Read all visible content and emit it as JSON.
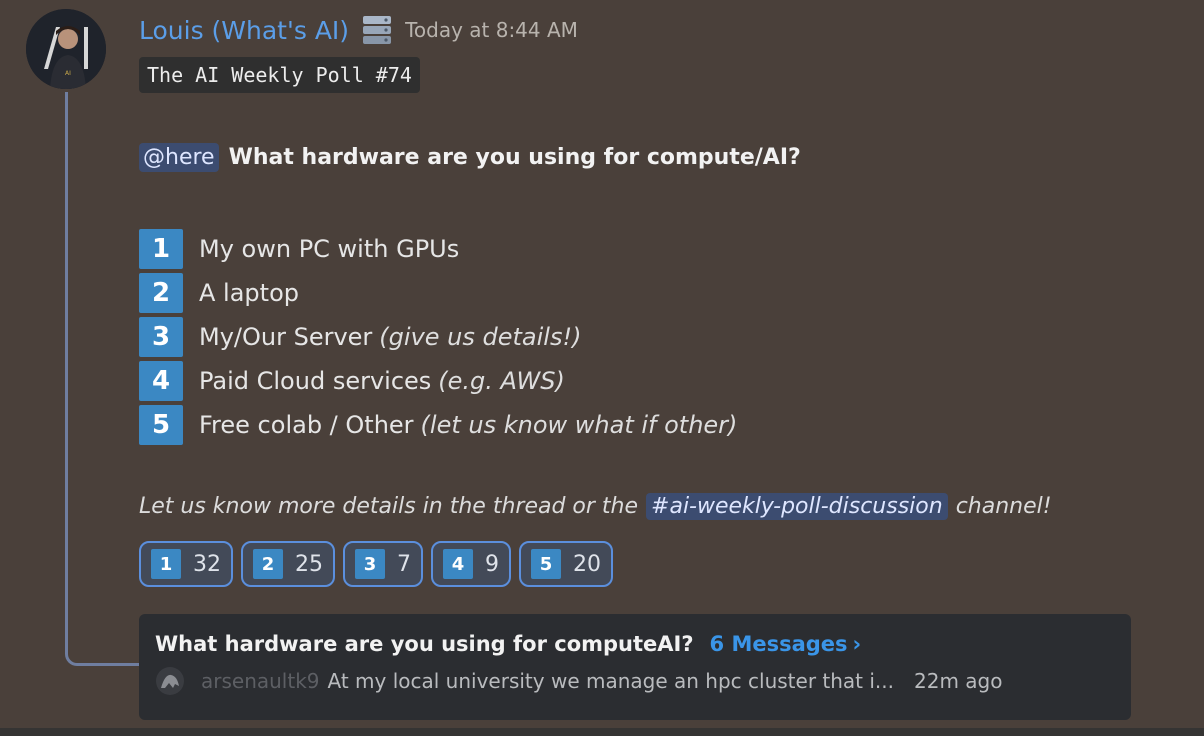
{
  "message": {
    "author": "Louis (What's AI)",
    "timestamp": "Today at 8:44 AM",
    "code_title": "The AI Weekly Poll #74",
    "mention": "@here",
    "question": "What hardware are you using for compute/AI?",
    "options": [
      {
        "number": "1",
        "text": "My own PC with GPUs",
        "note": ""
      },
      {
        "number": "2",
        "text": "A laptop",
        "note": ""
      },
      {
        "number": "3",
        "text": "My/Our Server",
        "note": "(give us details!)"
      },
      {
        "number": "4",
        "text": "Paid Cloud services",
        "note": "(e.g. AWS)"
      },
      {
        "number": "5",
        "text": "Free colab / Other",
        "note": "(let us know what if other)"
      }
    ],
    "footer_before": "Let us know more details in the thread or the",
    "channel": "#ai-weekly-poll-discussion",
    "footer_after": "channel!"
  },
  "reactions": [
    {
      "number": "1",
      "count": "32"
    },
    {
      "number": "2",
      "count": "25"
    },
    {
      "number": "3",
      "count": "7"
    },
    {
      "number": "4",
      "count": "9"
    },
    {
      "number": "5",
      "count": "20"
    }
  ],
  "thread": {
    "title": "What hardware are you using for computeAI?",
    "message_count": "6 Messages",
    "chevron": "›",
    "preview_user": "arsenaultk9",
    "preview_text": "At my local university we manage an hpc cluster that i...",
    "preview_time": "22m ago"
  },
  "colors": {
    "background": "#4a403a",
    "author": "#5b9ee8",
    "keycap_blue": "#3b88c3",
    "mention_bg": "#3c4c70",
    "thread_card_bg": "#2b2d31",
    "link_blue": "#3a95e8"
  },
  "icons": {
    "avatar": "user-avatar",
    "server_tag": "server-stack-icon",
    "preview_avatar": "small-user-avatar"
  }
}
